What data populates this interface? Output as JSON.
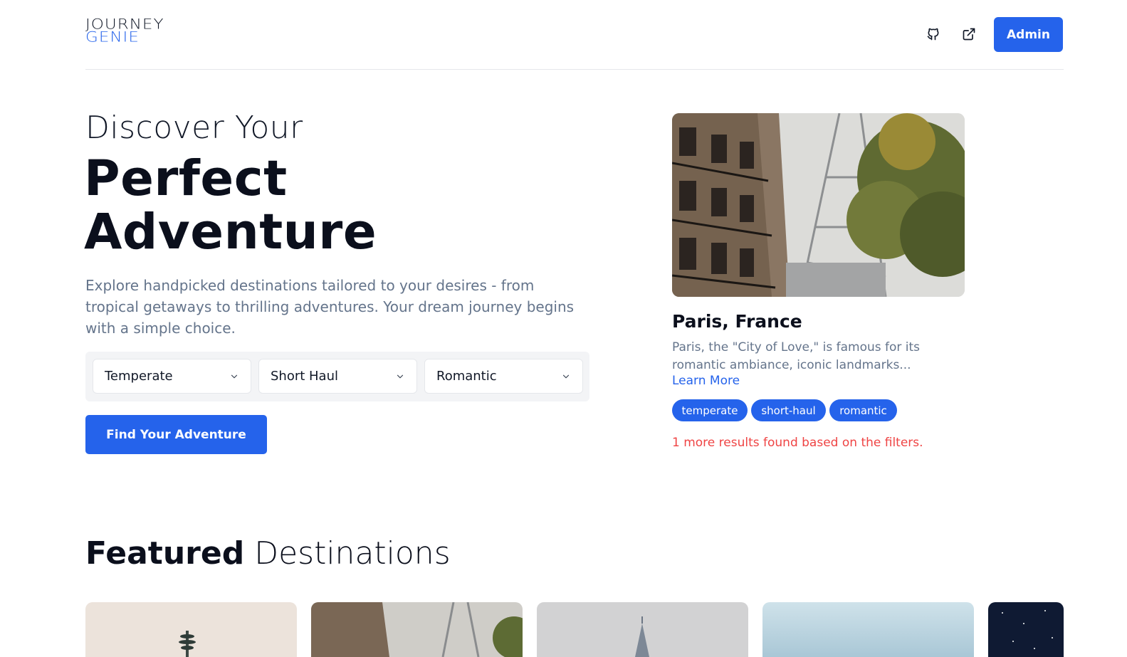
{
  "header": {
    "logo_line1": "Journey",
    "logo_line2": "Genie",
    "github_icon": "github-icon",
    "external_link_icon": "external-link-icon",
    "admin_label": "Admin"
  },
  "hero": {
    "pre_title": "Discover Your",
    "title_line1": "Perfect",
    "title_line2": "Adventure",
    "description": "Explore handpicked destinations tailored to your desires - from tropical getaways to thrilling adventures. Your dream journey begins with a simple choice.",
    "filters": [
      {
        "selected": "Temperate"
      },
      {
        "selected": "Short Haul"
      },
      {
        "selected": "Romantic"
      }
    ],
    "cta_label": "Find Your Adventure"
  },
  "result": {
    "title": "Paris, France",
    "description": "Paris, the \"City of Love,\" is famous for its romantic ambiance, iconic landmarks...",
    "learn_more": "Learn More",
    "tags": [
      "temperate",
      "short-haul",
      "romantic"
    ],
    "more_results": "1 more results found based on the filters."
  },
  "featured": {
    "title_bold": "Featured",
    "title_light": "Destinations"
  },
  "colors": {
    "accent": "#2563eb",
    "error": "#ef4444",
    "muted_text": "#64748b"
  }
}
